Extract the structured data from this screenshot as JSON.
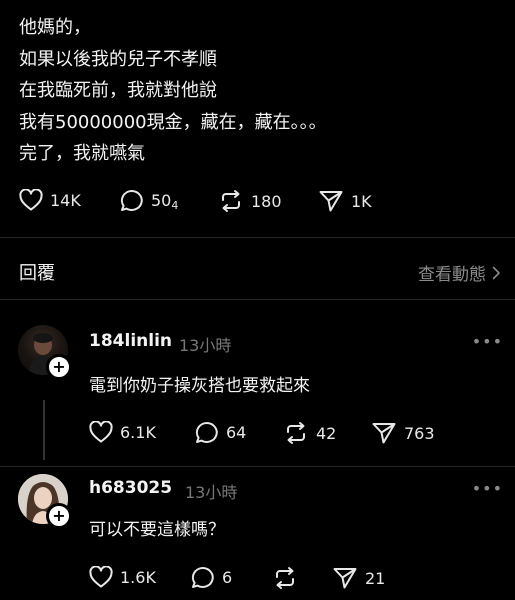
{
  "post": {
    "lines": [
      "他媽的，",
      "如果以後我的兒子不孝順",
      "在我臨死前，我就對他說",
      "我有50000000現金，藏在，藏在。。。",
      "完了，我就嚥氣"
    ],
    "likes": "14K",
    "comments": "50",
    "comments_sub": "4",
    "reposts": "180",
    "shares": "1K"
  },
  "replies_header": {
    "label": "回覆",
    "view_activity": "查看動態"
  },
  "replies": [
    {
      "username": "184linlin",
      "time": "13小時",
      "text": "電到你奶子操灰搭也要救起來",
      "likes": "6.1K",
      "comments": "64",
      "reposts": "42",
      "shares": "763"
    },
    {
      "username": "h683025",
      "time": "13小時",
      "text": "可以不要這樣嗎？",
      "likes": "1.6K",
      "comments": "6",
      "reposts": "",
      "shares": "21"
    }
  ],
  "more_symbol": "•••",
  "follow_symbol": "+",
  "colors": {
    "background": "#000000",
    "text": "#f3f3f3",
    "muted": "#777777",
    "divider": "#262626"
  }
}
